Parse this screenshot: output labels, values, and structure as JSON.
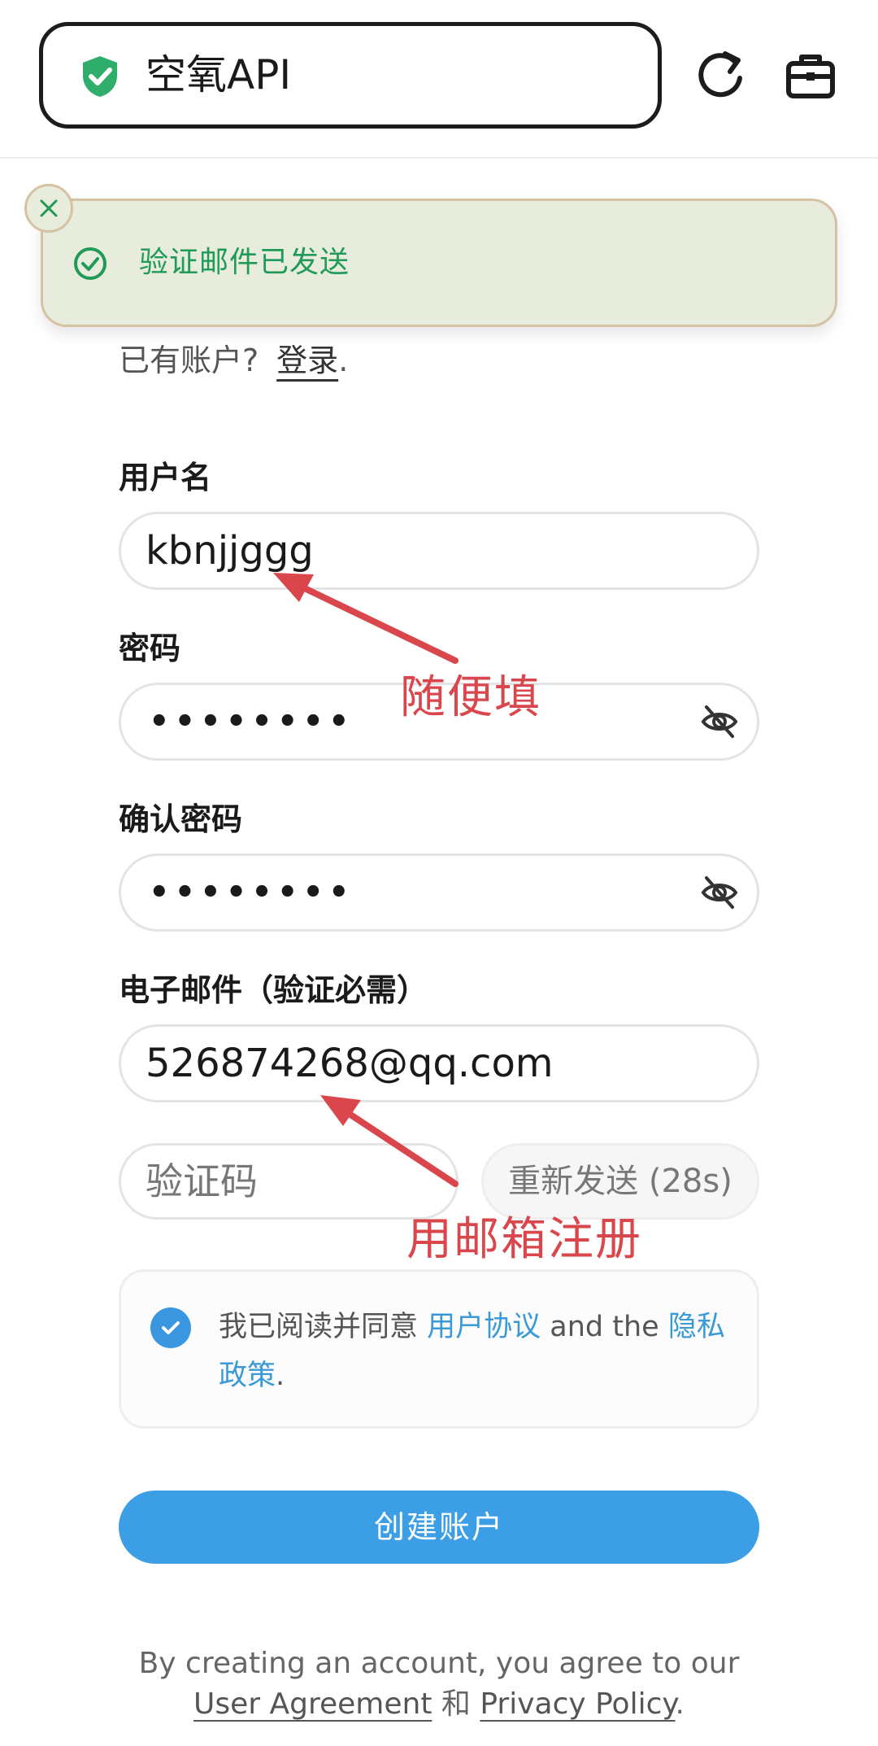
{
  "colors": {
    "accent_blue": "#3c9fe6",
    "link_blue": "#3a9ad6",
    "success_green": "#1f9a57",
    "toast_bg": "#e7ecdd",
    "annotation_red": "#d9474c"
  },
  "browser": {
    "address_text": "空氧API",
    "secure_icon": "shield-check-icon",
    "reload_icon": "reload-icon",
    "tools_icon": "toolbox-icon"
  },
  "toast": {
    "message": "验证邮件已发送",
    "close_icon": "close-icon",
    "status_icon": "check-circle-icon"
  },
  "login_hint": {
    "text": "已有账户?",
    "link": "登录",
    "suffix": "."
  },
  "form": {
    "username": {
      "label": "用户名",
      "value": "kbnjjggg"
    },
    "password": {
      "label": "密码",
      "masked_value": "••••••••"
    },
    "confirm_password": {
      "label": "确认密码",
      "masked_value": "••••••••"
    },
    "email": {
      "label": "电子邮件（验证必需）",
      "value": "526874268@qq.com"
    },
    "code": {
      "placeholder": "验证码"
    },
    "resend_label": "重新发送 (28s)"
  },
  "agreement": {
    "checked": true,
    "prefix": "我已阅读并同意 ",
    "user_agreement": "用户协议",
    "middle": " and the ",
    "privacy_policy": "隐私政策",
    "suffix": "."
  },
  "create_button": "创建账户",
  "footer": {
    "prefix": "By creating an account, you agree to our ",
    "user_agreement": "User Agreement",
    "middle": " 和 ",
    "privacy_policy": "Privacy Policy",
    "suffix": "."
  },
  "annotations": {
    "username_note": "随便填",
    "email_note": "用邮箱注册"
  }
}
